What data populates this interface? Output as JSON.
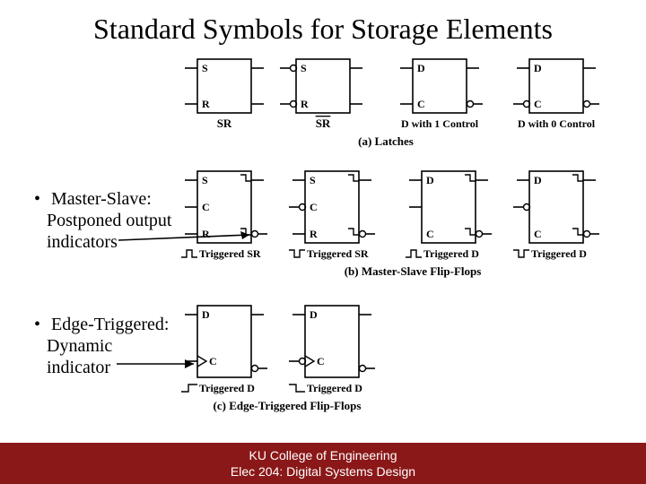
{
  "title": "Standard Symbols for Storage Elements",
  "bullets": {
    "ms": {
      "l1": "Master-Slave:",
      "l2": "Postponed output",
      "l3": "indicators"
    },
    "et": {
      "l1": "Edge-Triggered:",
      "l2": "Dynamic",
      "l3": "indicator"
    }
  },
  "rows": {
    "a": {
      "latch1": {
        "in1": "S",
        "in2": "R",
        "cap": "SR"
      },
      "latch2": {
        "in1": "S",
        "in2": "R",
        "cap": "SR"
      },
      "latch3": {
        "in1": "D",
        "in2": "C",
        "cap": "D with 1 Control"
      },
      "latch4": {
        "in1": "D",
        "in2": "C",
        "cap": "D with 0 Control"
      },
      "caption": "(a) Latches"
    },
    "b": {
      "ff1": {
        "in1": "S",
        "in2": "C",
        "in3": "R",
        "cap": "Triggered SR"
      },
      "ff2": {
        "in1": "S",
        "in2": "C",
        "in3": "R",
        "cap": "Triggered SR"
      },
      "ff3": {
        "in1": "D",
        "in2": "C",
        "cap": "Triggered D"
      },
      "ff4": {
        "in1": "D",
        "in2": "C",
        "cap": "Triggered D"
      },
      "caption": "(b) Master-Slave Flip-Flops"
    },
    "c": {
      "ff1": {
        "in1": "D",
        "in2": "C",
        "cap": "Triggered D"
      },
      "ff2": {
        "in1": "D",
        "in2": "C",
        "cap": "Triggered D"
      },
      "caption": "(c) Edge-Triggered Flip-Flops"
    }
  },
  "footer": {
    "l1": "KU College of Engineering",
    "l2": "Elec 204: Digital Systems Design"
  }
}
